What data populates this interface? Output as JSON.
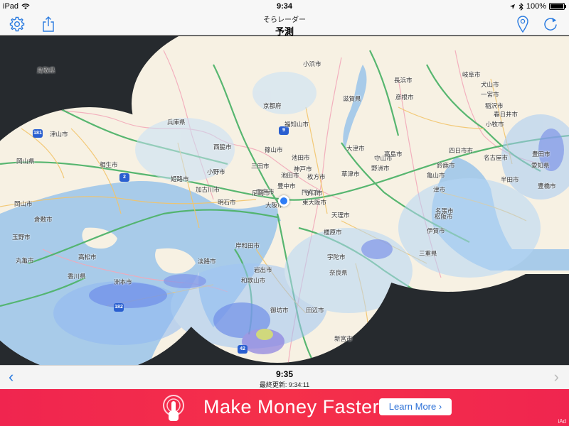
{
  "status": {
    "device": "iPad",
    "time": "9:34",
    "battery": "100%",
    "battery_level": 1.0
  },
  "nav": {
    "subtitle": "そらレーダー",
    "title": "予測"
  },
  "map": {
    "labels": [
      "鳥取県",
      "兵庫県",
      "京都府",
      "滋賀県",
      "岐阜市",
      "犬山市",
      "長浜市",
      "彦根市",
      "稲沢市",
      "春日井市",
      "一宮市",
      "小牧市",
      "豊田市",
      "名古屋市",
      "愛知県",
      "四日市市",
      "鈴鹿市",
      "半田市",
      "豊橋市",
      "津市",
      "松阪市",
      "三重県",
      "大津市",
      "草津市",
      "野洲市",
      "守山市",
      "高島市",
      "篠山市",
      "西脇市",
      "小野市",
      "三田市",
      "加古川市",
      "明石市",
      "姫路市",
      "神戸市",
      "西宮市",
      "池田市",
      "枚方市",
      "門真市",
      "東大阪市",
      "大阪市",
      "岸和田市",
      "和歌山市",
      "岩出市",
      "天理市",
      "名張市",
      "橿原市",
      "奈良県",
      "岡山県",
      "岡山市",
      "倉敷市",
      "玉野市",
      "津山市",
      "高松市",
      "香川県",
      "丸亀市",
      "淡路市",
      "小浜市",
      "福知山市",
      "御坊市",
      "田辺市",
      "洲本市",
      "相生市",
      "宇陀市",
      "伊賀市",
      "亀山市",
      "新宮市",
      "尼崎市",
      "守口市",
      "池田市",
      "豊中市"
    ],
    "routes": [
      "181",
      "2",
      "9",
      "42",
      "182"
    ]
  },
  "timebar": {
    "time": "9:35",
    "updated": "最終更新: 9:34:11",
    "prev": "‹",
    "next": "›"
  },
  "ad": {
    "headline": "Make Money Faster",
    "button": "Learn More",
    "tag": "iAd"
  },
  "colors": {
    "accent": "#2a7be0",
    "ad_bg": "#f0254f"
  }
}
